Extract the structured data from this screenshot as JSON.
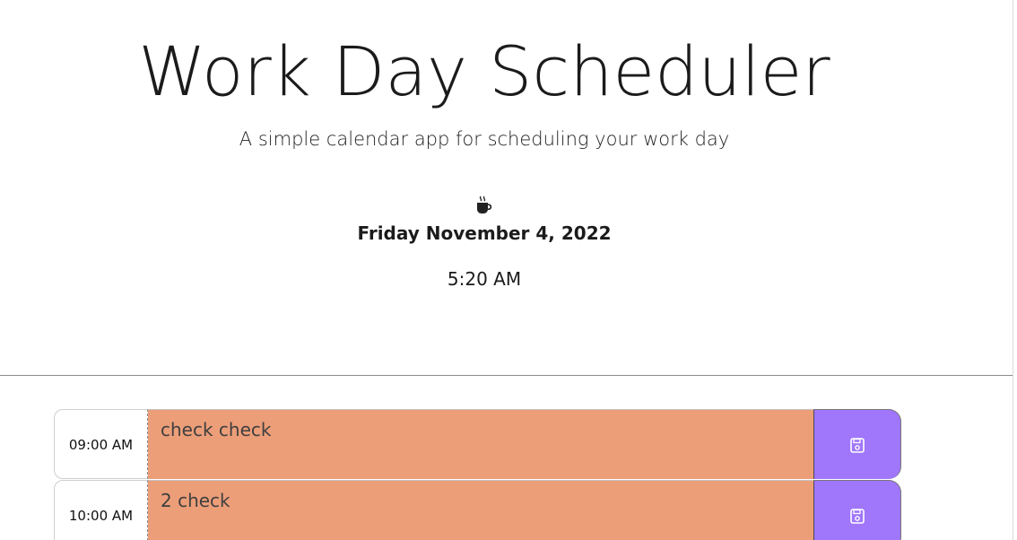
{
  "header": {
    "title": "Work Day Scheduler",
    "lead": "A simple calendar app for scheduling your work day",
    "icon": "coffee-icon",
    "date": "Friday November 4, 2022",
    "time": "5:20 AM"
  },
  "timeblocks": [
    {
      "hour": "09:00 AM",
      "text": "check check",
      "save_icon": "save-icon",
      "status": "present"
    },
    {
      "hour": "10:00 AM",
      "text": "2 check",
      "save_icon": "save-icon",
      "status": "present"
    }
  ],
  "colors": {
    "present": "#ec9e79",
    "save_button": "#a076fb",
    "divider": "#8c8c8c"
  }
}
